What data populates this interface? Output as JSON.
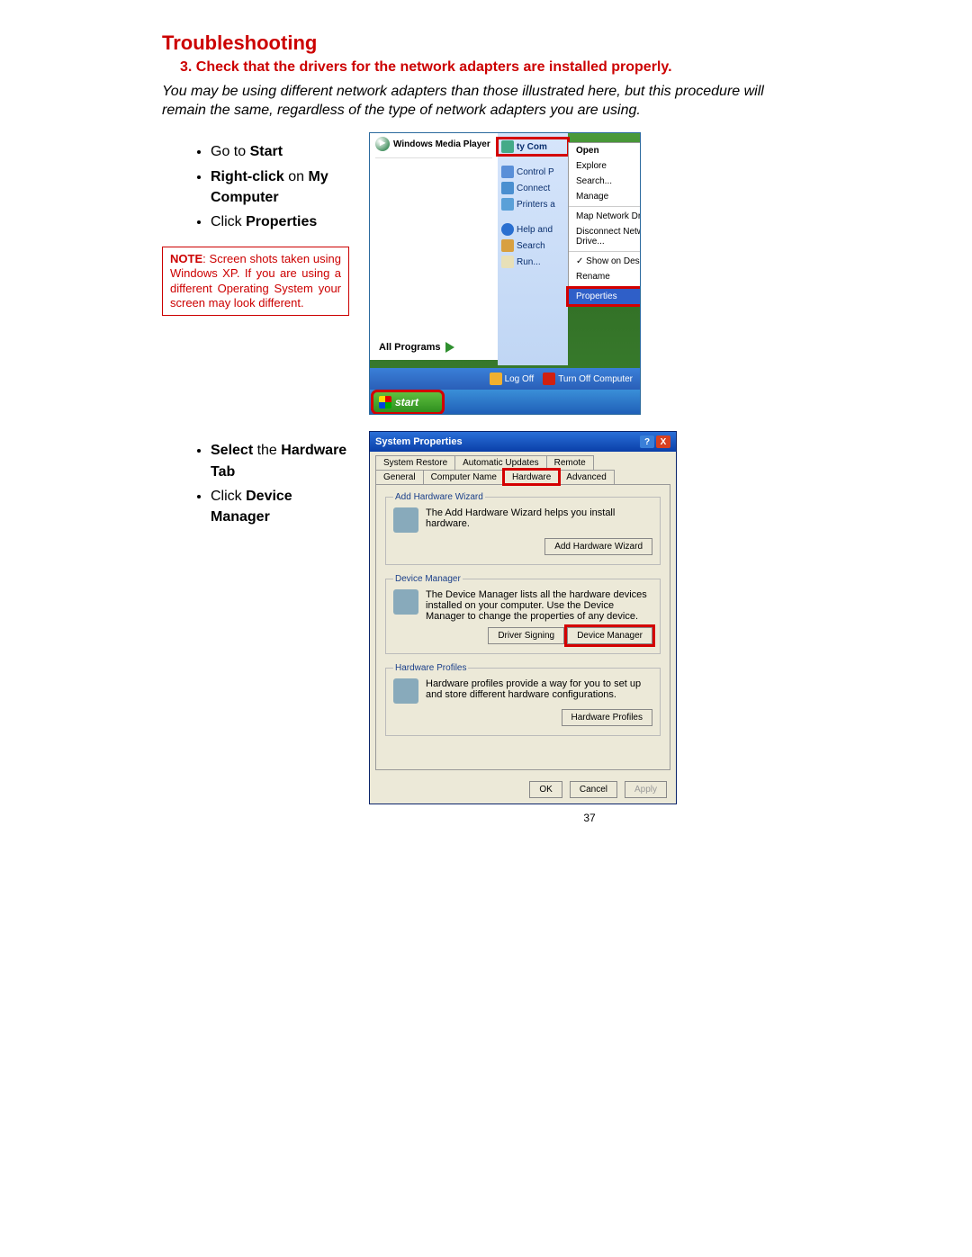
{
  "title": "Troubleshooting",
  "subhead": "3.  Check that the drivers for the network adapters are installed properly.",
  "intro": "You may be using different network adapters than those illustrated here, but this procedure will remain the same, regardless of the type of network adapters you are using.",
  "steps1": {
    "a_pre": "Go to ",
    "a_b": "Start",
    "b_b1": "Right-click",
    "b_mid": " on ",
    "b_b2": "My Computer",
    "c_pre": "Click ",
    "c_b": "Properties"
  },
  "note": {
    "label": "NOTE",
    "text": ": Screen shots taken using Windows XP. If you are using a different Operating System your screen may look different."
  },
  "steps2": {
    "a_b1": "Select",
    "a_mid": " the ",
    "a_b2": "Hardware Tab",
    "b_pre": "Click ",
    "b_b": "Device Manager"
  },
  "startmenu": {
    "wmp": "Windows Media Player",
    "allprograms": "All Programs",
    "right": {
      "mycomp": "ty Com",
      "ctrl": "Control P",
      "conn": "Connect",
      "print": "Printers a",
      "help": "Help and",
      "search": "Search",
      "run": "Run..."
    },
    "ctx": {
      "open": "Open",
      "explore": "Explore",
      "search": "Search...",
      "manage": "Manage",
      "mapnet": "Map Network Drive...",
      "disnet": "Disconnect Network Drive...",
      "show": "Show on Desktop",
      "rename": "Rename",
      "props": "Properties"
    },
    "footer": {
      "logoff": "Log Off",
      "turnoff": "Turn Off Computer"
    },
    "start": "start"
  },
  "sysprops": {
    "title": "System Properties",
    "tabs_row1": [
      "System Restore",
      "Automatic Updates",
      "Remote"
    ],
    "tabs_row2": [
      "General",
      "Computer Name",
      "Hardware",
      "Advanced"
    ],
    "add_legend": "Add Hardware Wizard",
    "add_text": "The Add Hardware Wizard helps you install hardware.",
    "add_btn": "Add Hardware Wizard",
    "dm_legend": "Device Manager",
    "dm_text": "The Device Manager lists all the hardware devices installed on your computer. Use the Device Manager to change the properties of any device.",
    "dm_btn1": "Driver Signing",
    "dm_btn2": "Device Manager",
    "hp_legend": "Hardware Profiles",
    "hp_text": "Hardware profiles provide a way for you to set up and store different hardware configurations.",
    "hp_btn": "Hardware Profiles",
    "ok": "OK",
    "cancel": "Cancel",
    "apply": "Apply"
  },
  "pagenum": "37"
}
